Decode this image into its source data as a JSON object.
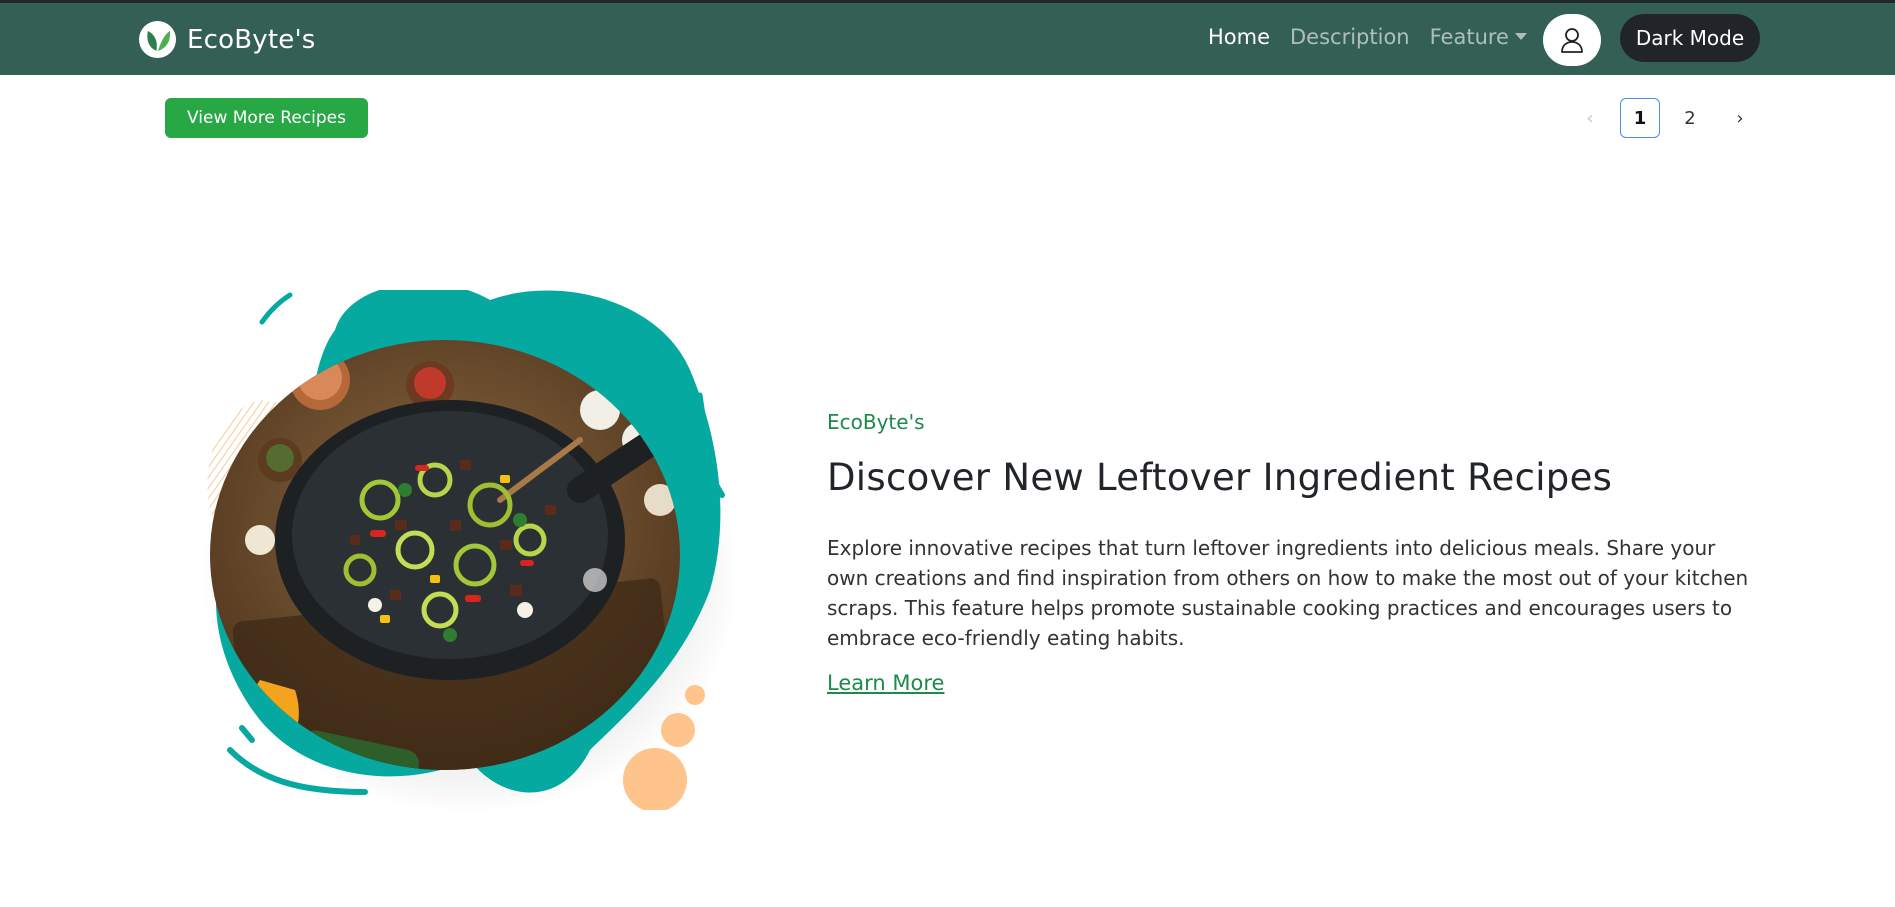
{
  "navbar": {
    "brand": "EcoByte's",
    "links": [
      {
        "label": "Home"
      },
      {
        "label": "Description"
      },
      {
        "label": "Feature"
      }
    ],
    "dark_mode_label": "Dark Mode"
  },
  "toolbar": {
    "view_more_label": "View More Recipes"
  },
  "pagination": {
    "prev": "‹",
    "pages": [
      "1",
      "2"
    ],
    "current": "1",
    "next": "›"
  },
  "hero": {
    "eyebrow": "EcoByte's",
    "title": "Discover New Leftover Ingredient Recipes",
    "description": "Explore innovative recipes that turn leftover ingredients into delicious meals. Share your own creations and find inspiration from others on how to make the most out of your kitchen scraps. This feature helps promote sustainable cooking practices and encourages users to embrace eco-friendly eating habits.",
    "link_label": "Learn More"
  },
  "icons": {
    "logo": "leaf-logo-icon",
    "avatar": "user-icon",
    "caret": "caret-down-icon"
  },
  "colors": {
    "navbar": "#345f55",
    "accent_green": "#28a745",
    "text_green": "#1e8a4c",
    "teal_blob": "#06a9a0",
    "peach": "#ffc48c",
    "dark_button": "#212529"
  }
}
